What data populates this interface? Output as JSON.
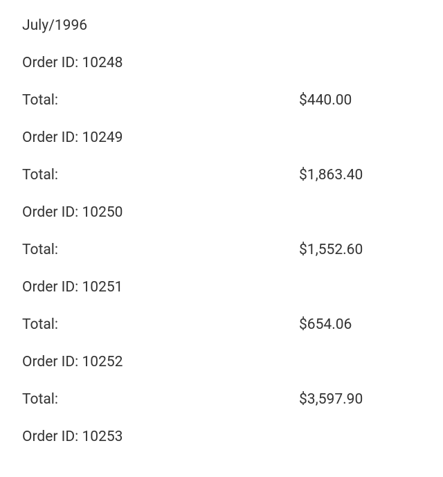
{
  "header": {
    "date": "July/1996"
  },
  "labels": {
    "order_id_prefix": "Order ID: ",
    "total_prefix": "Total:"
  },
  "orders": [
    {
      "id": "10248",
      "total": "$440.00"
    },
    {
      "id": "10249",
      "total": "$1,863.40"
    },
    {
      "id": "10250",
      "total": "$1,552.60"
    },
    {
      "id": "10251",
      "total": "$654.06"
    },
    {
      "id": "10252",
      "total": "$3,597.90"
    },
    {
      "id": "10253",
      "total": null
    }
  ]
}
